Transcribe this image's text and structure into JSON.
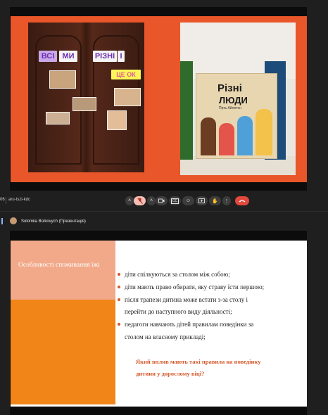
{
  "meeting": {
    "code_prefix": "06",
    "code": "aru-tszi-kdc"
  },
  "slide1": {
    "cards": {
      "vsi": "ВСІ",
      "my": "МИ",
      "rizni": "РІЗНІ",
      "i": "І",
      "tse_ok": "ЦЕ ОК"
    },
    "book": {
      "title_line1": "Різні",
      "title_line2": "ЛЮДИ",
      "author": "Прть Айлетон"
    }
  },
  "presenter": {
    "name": "Solomiia Boikovych (Презентація)"
  },
  "slide2": {
    "title": "Особливості споживання їжі",
    "bullets": [
      "діти спілкуються за столом між собою;",
      "діти мають право обирати, яку страву їсти першою;",
      "після трапези дитина може встати з-за столу і",
      "перейти до наступного виду діяльності;",
      "педагоги навчають дітей правилам поведінки за",
      "столом на власному прикладі;"
    ],
    "question_line1": "Який вплив мають такі правила на поведінку",
    "question_line2": "дитини у дорослому віці?"
  },
  "colors": {
    "slide_orange": "#e8562a",
    "panel_peach": "#f1a98a",
    "panel_orange": "#f18518",
    "accent": "#d4592c",
    "end_call_red": "#e2483d"
  },
  "icons": [
    "chevron-up-icon",
    "mic-off-icon",
    "chevron-up-icon",
    "camera-off-icon",
    "captions-icon",
    "emoji-icon",
    "present-icon",
    "raise-hand-icon",
    "more-icon",
    "end-call-icon"
  ]
}
